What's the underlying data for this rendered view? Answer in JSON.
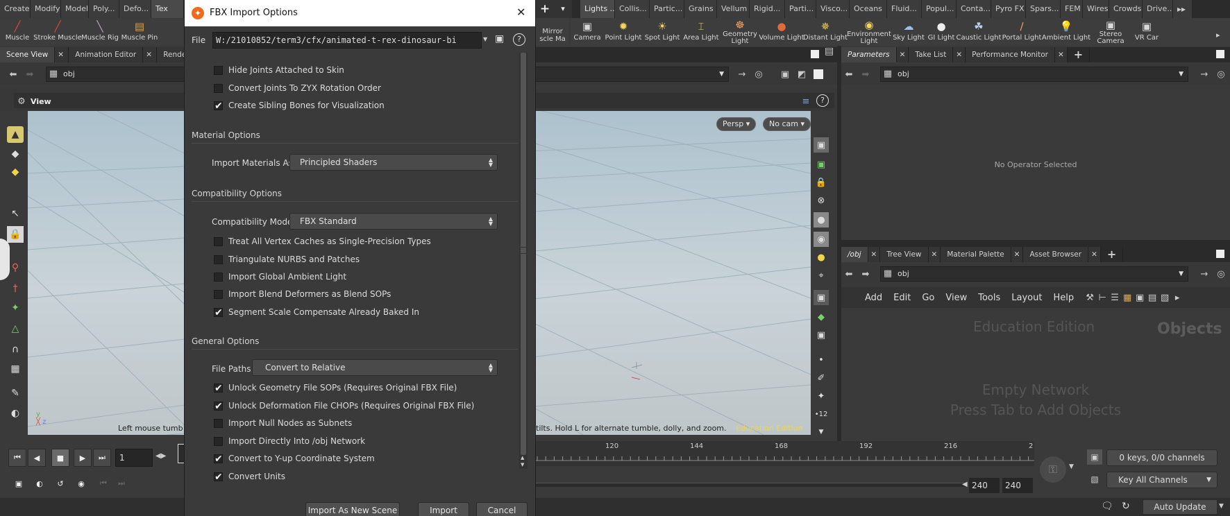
{
  "shelf_tabs_left": [
    "Create",
    "Modify",
    "Model",
    "Poly...",
    "Defo...",
    "Tex"
  ],
  "shelf_tabs_right": [
    "Lights ...",
    "Collis...",
    "Partic...",
    "Grains",
    "Vellum",
    "Rigid...",
    "Parti...",
    "Visco...",
    "Oceans",
    "Fluid...",
    "Popul...",
    "Conta...",
    "Pyro FX",
    "Spars...",
    "FEM",
    "Wires",
    "Crowds",
    "Drive..."
  ],
  "shelf_plus": "+",
  "shelf_tools_left": [
    {
      "label": "Muscle",
      "icon": "muscle-icon"
    },
    {
      "label": "Stroke Muscle",
      "icon": "stroke-muscle-icon"
    },
    {
      "label": "Muscle Rig",
      "icon": "muscle-rig-icon"
    },
    {
      "label": "Muscle Pin",
      "icon": "muscle-pin-icon"
    }
  ],
  "shelf_tool_partial": "Mirror\nscle Ma",
  "shelf_tools_right": [
    {
      "label": "Camera",
      "icon": "camera-icon"
    },
    {
      "label": "Point Light",
      "icon": "point-light-icon"
    },
    {
      "label": "Spot Light",
      "icon": "spot-light-icon"
    },
    {
      "label": "Area Light",
      "icon": "area-light-icon"
    },
    {
      "label": "Geometry\nLight",
      "icon": "geometry-light-icon"
    },
    {
      "label": "Volume Light",
      "icon": "volume-light-icon"
    },
    {
      "label": "Distant Light",
      "icon": "distant-light-icon"
    },
    {
      "label": "Environment\nLight",
      "icon": "environment-light-icon"
    },
    {
      "label": "Sky Light",
      "icon": "sky-light-icon"
    },
    {
      "label": "GI Light",
      "icon": "gi-light-icon"
    },
    {
      "label": "Caustic Light",
      "icon": "caustic-light-icon"
    },
    {
      "label": "Portal Light",
      "icon": "portal-light-icon"
    },
    {
      "label": "Ambient Light",
      "icon": "ambient-light-icon"
    },
    {
      "label": "Stereo\nCamera",
      "icon": "stereo-camera-icon"
    },
    {
      "label": "VR Car",
      "icon": "vr-camera-icon"
    }
  ],
  "left_pane": {
    "tabs": [
      "Scene View",
      "Animation Editor",
      "Render V"
    ],
    "path": "obj",
    "view_label": "View",
    "persp": "Persp ▾",
    "cam": "No cam ▾",
    "status_left": "Left mouse tumb",
    "status_right": "tilts. Hold L for alternate tumble, dolly, and zoom.",
    "watermark": "Education Edition"
  },
  "params_pane": {
    "tabs": [
      "Parameters",
      "Take List",
      "Performance Monitor"
    ],
    "path": "obj",
    "empty": "No Operator Selected"
  },
  "network_pane": {
    "tabs": [
      "/obj",
      "Tree View",
      "Material Palette",
      "Asset Browser"
    ],
    "path": "obj",
    "menu": [
      "Add",
      "Edit",
      "Go",
      "View",
      "Tools",
      "Layout",
      "Help"
    ],
    "edition": "Education Edition",
    "context": "Objects",
    "empty1": "Empty Network",
    "empty2": "Press Tab to Add Objects"
  },
  "dialog": {
    "title": "FBX Import Options",
    "file_label": "File",
    "file_value": "W:/21010852/term3/cfx/animated-t-rex-dinosaur-bi",
    "skel_checks": [
      {
        "label": "Hide Joints Attached to Skin",
        "checked": false
      },
      {
        "label": "Convert Joints To ZYX Rotation Order",
        "checked": false
      },
      {
        "label": "Create Sibling Bones for Visualization",
        "checked": true
      }
    ],
    "material_section": "Material Options",
    "import_materials_label": "Import Materials As",
    "import_materials_value": "Principled Shaders",
    "compat_section": "Compatibility Options",
    "compat_mode_label": "Compatibility Mode",
    "compat_mode_value": "FBX Standard",
    "compat_checks": [
      {
        "label": "Treat All Vertex Caches as Single-Precision Types",
        "checked": false
      },
      {
        "label": "Triangulate NURBS and Patches",
        "checked": false
      },
      {
        "label": "Import Global Ambient Light",
        "checked": false
      },
      {
        "label": "Import Blend Deformers as Blend SOPs",
        "checked": false
      },
      {
        "label": "Segment Scale Compensate Already Baked In",
        "checked": true
      }
    ],
    "general_section": "General Options",
    "file_paths_label": "File Paths",
    "file_paths_value": "Convert to Relative",
    "general_checks": [
      {
        "label": "Unlock Geometry File SOPs (Requires Original FBX File)",
        "checked": true
      },
      {
        "label": "Unlock Deformation File CHOPs (Requires Original FBX File)",
        "checked": true
      },
      {
        "label": "Import Null Nodes as Subnets",
        "checked": false
      },
      {
        "label": "Import Directly Into /obj Network",
        "checked": false
      },
      {
        "label": "Convert to Y-up Coordinate System",
        "checked": true
      },
      {
        "label": "Convert Units",
        "checked": true
      }
    ],
    "buttons": [
      "Import As New Scene",
      "Import",
      "Cancel"
    ],
    "close": "✕",
    "help": "?"
  },
  "timeline": {
    "frame": "1",
    "ticks": [
      "120",
      "144",
      "168",
      "192",
      "216",
      "2"
    ],
    "end1": "240",
    "end2": "240",
    "keys": "0 keys, 0/0 channels",
    "key_all": "Key All Channels",
    "auto_update": "Auto Update"
  },
  "colors": {
    "accent": "#e8d84a",
    "dialog_bg": "#3a3a3a",
    "viewport_top": "#adc2ce"
  }
}
